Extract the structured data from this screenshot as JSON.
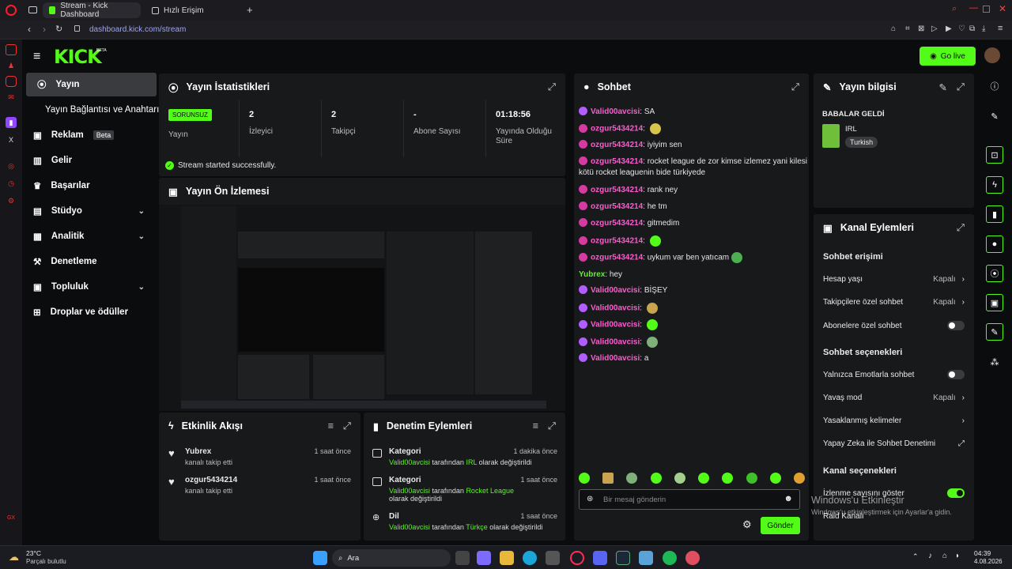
{
  "browser": {
    "tabs": [
      {
        "label": "Stream - Kick Dashboard"
      },
      {
        "label": "Hızlı Erişim"
      }
    ],
    "url": "dashboard.kick.com/stream"
  },
  "header": {
    "logo": "KICK",
    "logo_sup": "BETA",
    "go_live": "Go live"
  },
  "sidebar": {
    "items": [
      {
        "label": "Yayın"
      },
      {
        "label": "Yayın Bağlantısı ve Anahtarı"
      },
      {
        "label": "Reklam",
        "badge": "Beta"
      },
      {
        "label": "Gelir"
      },
      {
        "label": "Başarılar"
      },
      {
        "label": "Stüdyo"
      },
      {
        "label": "Analitik"
      },
      {
        "label": "Denetleme"
      },
      {
        "label": "Topluluk"
      },
      {
        "label": "Droplar ve ödüller"
      }
    ]
  },
  "stats": {
    "title": "Yayın İstatistikleri",
    "badge": "SORUNSUZ",
    "status_label": "Yayın",
    "viewers_value": "2",
    "viewers_label": "İzleyici",
    "followers_value": "2",
    "followers_label": "Takipçi",
    "subs_value": "-",
    "subs_label": "Abone Sayısı",
    "uptime_value": "01:18:56",
    "uptime_label": "Yayında Olduğu Süre",
    "success": "Stream started successfully."
  },
  "preview": {
    "title": "Yayın Ön İzlemesi"
  },
  "activity": {
    "title": "Etkinlik Akışı",
    "items": [
      {
        "user": "Yubrex",
        "desc": "kanalı takip etti",
        "time": "1 saat önce"
      },
      {
        "user": "ozgur5434214",
        "desc": "kanalı takip etti",
        "time": "1 saat önce"
      }
    ]
  },
  "modactions": {
    "title": "Denetim Eylemleri",
    "items": [
      {
        "type": "Kategori",
        "user": "Valid00avcisi",
        "pre": "tarafından",
        "value": "IRL",
        "post": "olarak değiştirildi",
        "time": "1 dakika önce"
      },
      {
        "type": "Kategori",
        "user": "Valid00avcisi",
        "pre": "tarafından",
        "value": "Rocket League",
        "post": "olarak değiştirildi",
        "time": "1 saat önce"
      },
      {
        "type": "Dil",
        "user": "Valid00avcisi",
        "pre": "tarafından",
        "value": "Türkçe",
        "post": "olarak değiştirildi",
        "time": "1 saat önce"
      }
    ]
  },
  "chat": {
    "title": "Sohbet",
    "messages": [
      {
        "user": "Valid00avcisi",
        "text": "SA"
      },
      {
        "user": "ozgur5434214",
        "text": ""
      },
      {
        "user": "ozgur5434214",
        "text": "iyiyim sen"
      },
      {
        "user": "ozgur5434214",
        "text": "rocket league de zor kimse izlemez yani kilesi kötü rocket leaguenin bide türkiyede"
      },
      {
        "user": "ozgur5434214",
        "text": "rank ney"
      },
      {
        "user": "ozgur5434214",
        "text": "he tm"
      },
      {
        "user": "ozgur5434214",
        "text": "gitmedim"
      },
      {
        "user": "ozgur5434214",
        "text": ""
      },
      {
        "user": "ozgur5434214",
        "text": "uykum var ben yatıcam"
      },
      {
        "user": "Yubrex",
        "text": "hey"
      },
      {
        "user": "Valid00avcisi",
        "text": "BİŞEY"
      },
      {
        "user": "Valid00avcisi",
        "text": ""
      },
      {
        "user": "Valid00avcisi",
        "text": ""
      },
      {
        "user": "Valid00avcisi",
        "text": ""
      },
      {
        "user": "Valid00avcisi",
        "text": "a"
      }
    ],
    "placeholder": "Bir mesaj gönderin",
    "send": "Gönder"
  },
  "streaminfo": {
    "title": "Yayın bilgisi",
    "stream_title": "BABALAR GELDİ",
    "category": "IRL",
    "language": "Turkish"
  },
  "channel": {
    "title": "Kanal Eylemleri",
    "chat_access": "Sohbet erişimi",
    "account_age": "Hesap yaşı",
    "account_age_value": "Kapalı",
    "followers_only": "Takipçilere özel sohbet",
    "followers_only_value": "Kapalı",
    "subs_only": "Abonelere özel sohbet",
    "chat_options": "Sohbet seçenekleri",
    "emotes_only": "Yalnızca Emotlarla sohbet",
    "slow_mode": "Yavaş mod",
    "slow_mode_value": "Kapalı",
    "banned_words": "Yasaklanmış kelimeler",
    "ai_mod": "Yapay Zeka ile Sohbet Denetimi",
    "channel_options": "Kanal seçenekleri",
    "show_viewers": "İzlenme sayısını göster",
    "raid": "Raid Kanalı"
  },
  "watermark": {
    "line1": "Windows'u Etkinleştir",
    "line2": "Windows'u etkinleştirmek için Ayarlar'a gidin."
  },
  "taskbar": {
    "temp": "23°C",
    "weather": "Parçalı bulutlu",
    "search": "Ara",
    "time": "04:39",
    "date": "4.08.2026"
  },
  "colors": {
    "brand": "#53fc18",
    "username_pink": "#ff5ad1",
    "panel": "#18191b"
  }
}
